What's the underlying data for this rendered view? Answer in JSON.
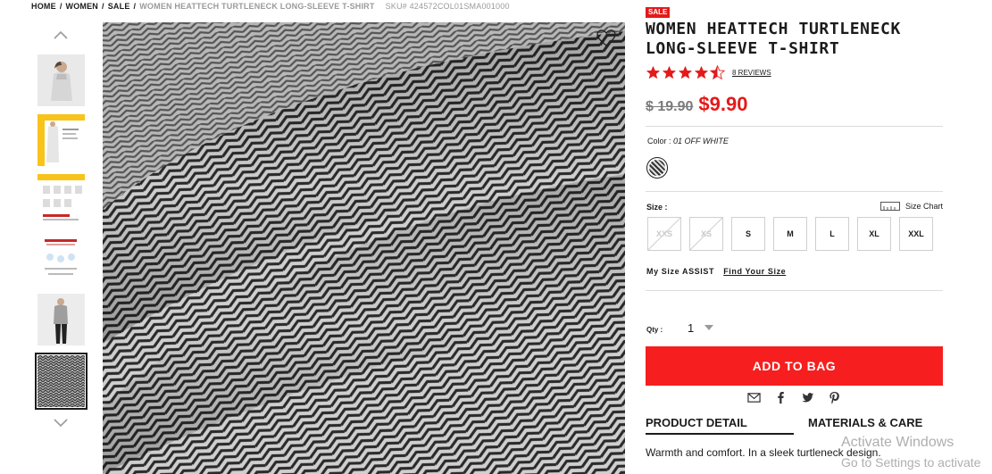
{
  "breadcrumb": {
    "home": "HOME",
    "women": "WOMEN",
    "sale": "SALE",
    "current": "WOMEN HEATTECH TURTLENECK LONG-SLEEVE T-SHIRT",
    "sku": "SKU# 424572COL01SMA001000"
  },
  "product": {
    "badge": "SALE",
    "title_line1": "WOMEN HEATTECH TURTLENECK",
    "title_line2": "LONG-SLEEVE T-SHIRT",
    "rating": 4.5,
    "reviews": "8 REVIEWS",
    "old_price": "$ 19.90",
    "new_price": "$9.90",
    "color_label": "Color :",
    "color_value": "01 OFF WHITE",
    "size_label": "Size :",
    "size_chart": "Size Chart",
    "sizes": [
      "XXS",
      "XS",
      "S",
      "M",
      "L",
      "XL",
      "XXL"
    ],
    "mysize_label": "My Size ASSIST",
    "mysize_link": "Find Your Size",
    "qty_label": "Qty :",
    "qty_value": "1",
    "add_to_bag": "ADD TO BAG",
    "tab_detail": "PRODUCT DETAIL",
    "tab_materials": "MATERIALS & CARE",
    "description": "Warmth and comfort. In a sleek turtleneck design."
  },
  "watermark": {
    "line1": "Activate Windows",
    "line2": "Go to Settings to activate"
  },
  "colors": {
    "sale_red": "#e41a1a",
    "button_red": "#f61e1e",
    "star_red": "#e41a1a"
  }
}
